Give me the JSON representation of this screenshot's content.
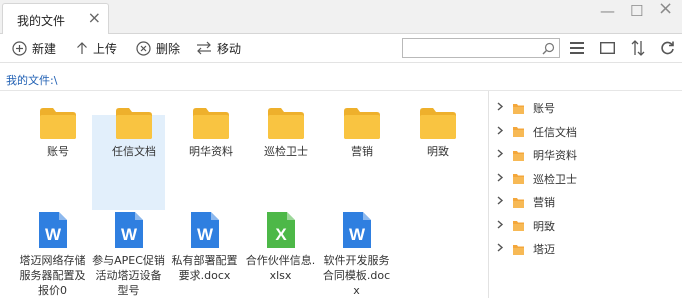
{
  "window": {
    "tab_title": "我的文件",
    "tab_close": "×",
    "minimize": "—",
    "maximize": "☐",
    "close": "×"
  },
  "toolbar": {
    "new_label": "新建",
    "upload_label": "上传",
    "delete_label": "删除",
    "move_label": "移动",
    "search_placeholder": ""
  },
  "breadcrumb": "我的文件:\\",
  "folders": [
    {
      "name": "账号"
    },
    {
      "name": "任信文档"
    },
    {
      "name": "明华资料"
    },
    {
      "name": "巡检卫士"
    },
    {
      "name": "营销"
    },
    {
      "name": "明致"
    }
  ],
  "files": [
    {
      "name": "塔迈网络存储服务器配置及报价0",
      "type": "word",
      "letter": "W",
      "selected": false
    },
    {
      "name": "参与APEC促销活动塔迈设备型号",
      "type": "word",
      "letter": "W",
      "selected": true
    },
    {
      "name": "私有部署配置要求.docx",
      "type": "word",
      "letter": "W",
      "selected": false
    },
    {
      "name": "合作伙伴信息.xlsx",
      "type": "excel",
      "letter": "X",
      "selected": false
    },
    {
      "name": "软件开发服务合同模板.docx",
      "type": "word",
      "letter": "W",
      "selected": false
    }
  ],
  "tree": [
    {
      "label": "账号"
    },
    {
      "label": "任信文档"
    },
    {
      "label": "明华资料"
    },
    {
      "label": "巡检卫士"
    },
    {
      "label": "营销"
    },
    {
      "label": "明致"
    },
    {
      "label": "塔迈"
    }
  ],
  "colors": {
    "folder": "#f9c441",
    "folder_dark": "#eeb02c",
    "word": "#2f7fe0",
    "excel": "#4db848",
    "tree_folder": "#f4a73b",
    "link": "#1f5fb3"
  }
}
